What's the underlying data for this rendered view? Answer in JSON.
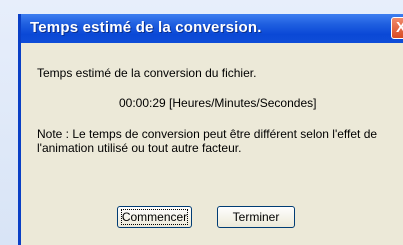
{
  "window": {
    "title": "Temps estimé de la conversion.",
    "close_label": "X"
  },
  "content": {
    "line1": "Temps estimé de la conversion du fichier.",
    "line2": "00:00:29 [Heures/Minutes/Secondes]",
    "line3": "Note : Le temps de conversion peut être différent selon l'effet de l'animation utilisé ou tout autre facteur."
  },
  "buttons": {
    "start": "Commencer",
    "stop": "Terminer"
  }
}
